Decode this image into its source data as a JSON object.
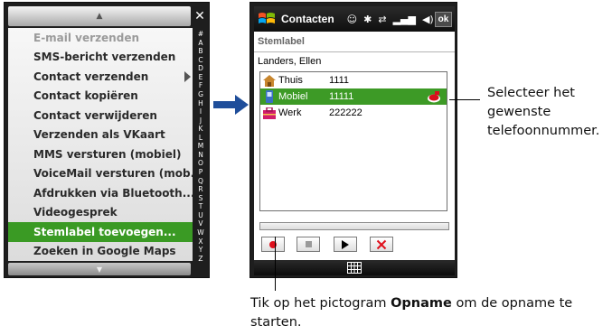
{
  "menu_screen": {
    "close_label": "✕",
    "items": [
      {
        "label": "E-mail verzenden",
        "state": "disabled"
      },
      {
        "label": "SMS-bericht verzenden",
        "state": "normal"
      },
      {
        "label": "Contact verzenden",
        "state": "normal",
        "submenu": true
      },
      {
        "label": "Contact kopiëren",
        "state": "normal"
      },
      {
        "label": "Contact verwijderen",
        "state": "normal"
      },
      {
        "label": "Verzenden als VKaart",
        "state": "normal"
      },
      {
        "label": "MMS versturen (mobiel)",
        "state": "normal"
      },
      {
        "label": "VoiceMail versturen (mob...",
        "state": "normal"
      },
      {
        "label": "Afdrukken via Bluetooth...",
        "state": "normal"
      },
      {
        "label": "Videogesprek",
        "state": "normal"
      },
      {
        "label": "Stemlabel toevoegen...",
        "state": "selected"
      },
      {
        "label": "Zoeken in Google Maps",
        "state": "normal"
      }
    ],
    "alpha_index": [
      "#",
      "A",
      "B",
      "C",
      "D",
      "E",
      "F",
      "G",
      "H",
      "I",
      "J",
      "K",
      "L",
      "M",
      "N",
      "O",
      "P",
      "Q",
      "R",
      "S",
      "T",
      "U",
      "V",
      "W",
      "X",
      "Y",
      "Z"
    ]
  },
  "voice_screen": {
    "titlebar": {
      "title": "Contacten",
      "ok_label": "ok",
      "icons": [
        "message-icon",
        "bluetooth-icon",
        "network-icon",
        "signal-icon",
        "volume-icon"
      ]
    },
    "page_title": "Stemlabel",
    "contact_name": "Landers, Ellen",
    "numbers": [
      {
        "label": "Thuis",
        "value": "1111",
        "icon": "home-icon"
      },
      {
        "label": "Mobiel",
        "value": "11111",
        "icon": "mobile-phone-icon",
        "voice_tag": true
      },
      {
        "label": "Werk",
        "value": "222222",
        "icon": "work-icon"
      }
    ],
    "selected_number_index": 1,
    "controls": [
      "record-button",
      "stop-button",
      "play-button",
      "delete-button"
    ],
    "softkey_icon": "keyboard-icon"
  },
  "callouts": {
    "right": "Selecteer het gewenste telefoonnummer.",
    "bottom_prefix": "Tik op het pictogram ",
    "bottom_bold": "Opname",
    "bottom_suffix": " om de opname te starten."
  },
  "colors": {
    "selection_green": "#3a9a24",
    "arrow_blue": "#1f4e9a",
    "record_red": "#e0101c"
  }
}
